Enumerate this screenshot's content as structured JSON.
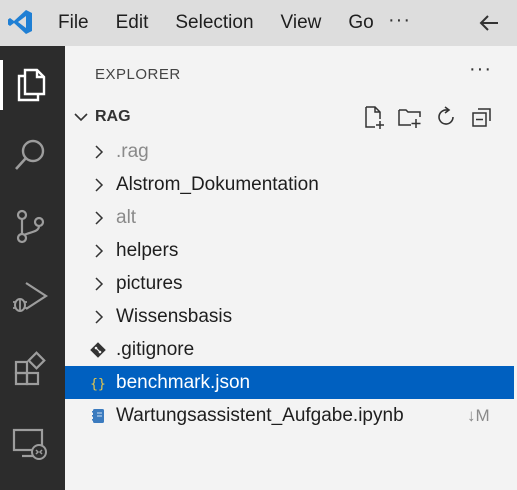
{
  "menu": {
    "file": "File",
    "edit": "Edit",
    "selection": "Selection",
    "view": "View",
    "go": "Go",
    "more": "···"
  },
  "icons": {
    "app_logo": "vscode-logo",
    "back": "arrow-left-icon",
    "explorer": "files-icon",
    "search": "search-icon",
    "source_control": "source-control-icon",
    "run_debug": "run-debug-icon",
    "extensions": "extensions-icon",
    "remote": "remote-explorer-icon"
  },
  "colors": {
    "accent_blue": "#0060c0",
    "logo_blue": "#1f7fd4",
    "json_brace": "#c9a400",
    "notebook": "#3b7bbf"
  },
  "sidebar": {
    "title": "EXPLORER",
    "more": "···",
    "section": {
      "title": "RAG"
    },
    "items": [
      {
        "label": ".rag",
        "type": "folder",
        "dim": true
      },
      {
        "label": "Alstrom_Dokumentation",
        "type": "folder",
        "dim": false
      },
      {
        "label": "alt",
        "type": "folder",
        "dim": true
      },
      {
        "label": "helpers",
        "type": "folder",
        "dim": false
      },
      {
        "label": "pictures",
        "type": "folder",
        "dim": false
      },
      {
        "label": "Wissensbasis",
        "type": "folder",
        "dim": false
      },
      {
        "label": ".gitignore",
        "type": "git",
        "dim": false
      },
      {
        "label": "benchmark.json",
        "type": "json",
        "dim": false,
        "selected": true
      },
      {
        "label": "Wartungsassistent_Aufgabe.ipynb",
        "type": "notebook",
        "dim": false,
        "badge": "↓M"
      }
    ]
  }
}
